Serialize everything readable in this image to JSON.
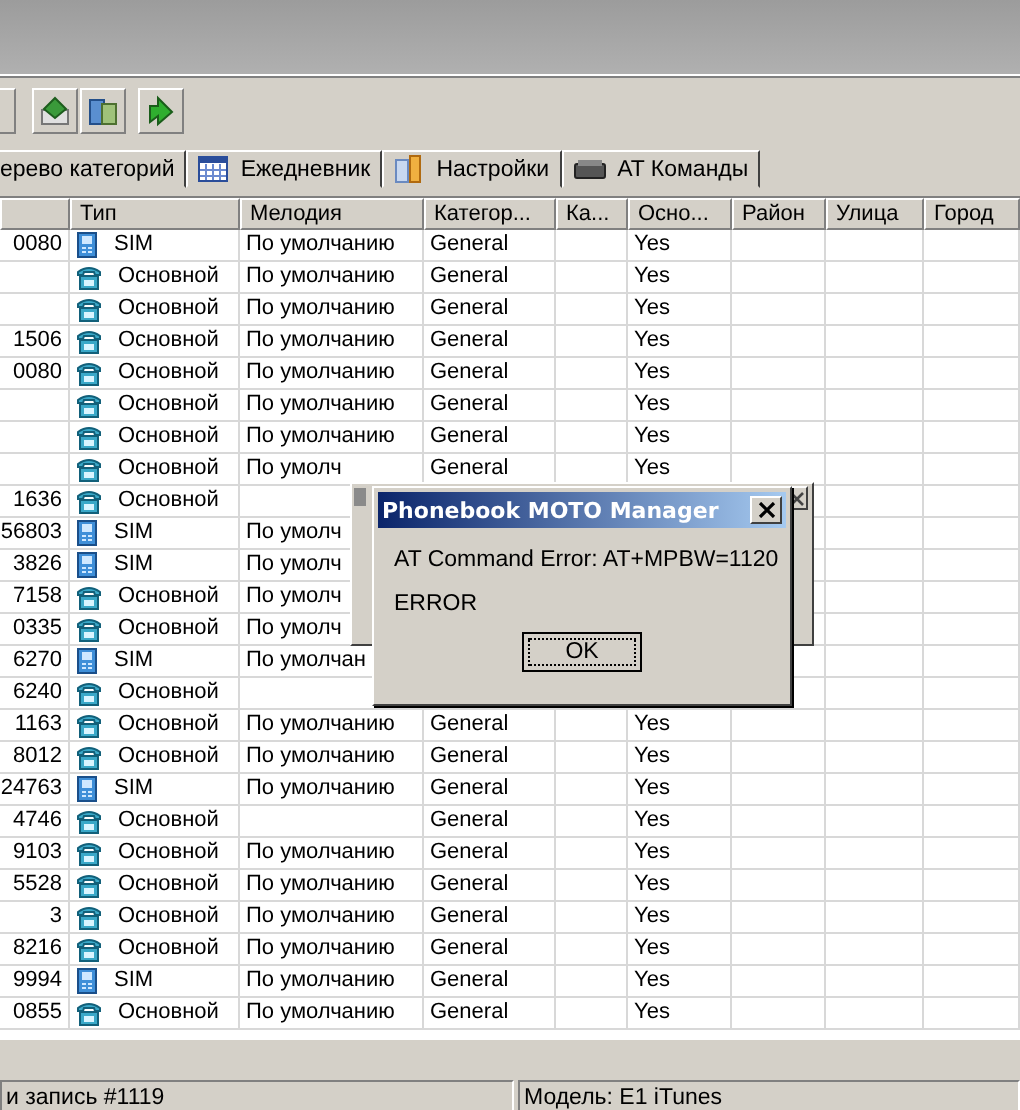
{
  "tabs": [
    {
      "label": "ерево категорий",
      "selected": false
    },
    {
      "label": "Ежедневник",
      "selected": false
    },
    {
      "label": "Настройки",
      "selected": false
    },
    {
      "label": "AT Команды",
      "selected": false
    }
  ],
  "table": {
    "columns": [
      "Тип",
      "Мелодия",
      "Категор...",
      "Ка...",
      "Осно...",
      "Район",
      "Улица",
      "Город"
    ],
    "rows": [
      {
        "number": "0080",
        "kind": "sim",
        "type": "SIM",
        "melody": "По умолчанию",
        "category": "General",
        "main": "Yes"
      },
      {
        "number": "",
        "kind": "main",
        "type": "Основной",
        "melody": "По умолчанию",
        "category": "General",
        "main": "Yes"
      },
      {
        "number": "",
        "kind": "main",
        "type": "Основной",
        "melody": "По умолчанию",
        "category": "General",
        "main": "Yes"
      },
      {
        "number": "1506",
        "kind": "main",
        "type": "Основной",
        "melody": "По умолчанию",
        "category": "General",
        "main": "Yes"
      },
      {
        "number": "0080",
        "kind": "main",
        "type": "Основной",
        "melody": "По умолчанию",
        "category": "General",
        "main": "Yes"
      },
      {
        "number": "",
        "kind": "main",
        "type": "Основной",
        "melody": "По умолчанию",
        "category": "General",
        "main": "Yes"
      },
      {
        "number": "",
        "kind": "main",
        "type": "Основной",
        "melody": "По умолчанию",
        "category": "General",
        "main": "Yes"
      },
      {
        "number": "",
        "kind": "main",
        "type": "Основной",
        "melody": "По умолч",
        "category": "General",
        "main": "Yes"
      },
      {
        "number": "1636",
        "kind": "main",
        "type": "Основной",
        "melody": "",
        "category": "",
        "main": ""
      },
      {
        "number": "56803",
        "kind": "sim",
        "type": "SIM",
        "melody": "По умолч",
        "category": "",
        "main": ""
      },
      {
        "number": "3826",
        "kind": "sim",
        "type": "SIM",
        "melody": "По умолч",
        "category": "",
        "main": ""
      },
      {
        "number": "7158",
        "kind": "main",
        "type": "Основной",
        "melody": "По умолч",
        "category": "",
        "main": ""
      },
      {
        "number": "0335",
        "kind": "main",
        "type": "Основной",
        "melody": "По умолч",
        "category": "",
        "main": ""
      },
      {
        "number": "6270",
        "kind": "sim",
        "type": "SIM",
        "melody": "По умолчан",
        "category": "",
        "main": ""
      },
      {
        "number": "6240",
        "kind": "main",
        "type": "Основной",
        "melody": "",
        "category": "",
        "main": ""
      },
      {
        "number": "1163",
        "kind": "main",
        "type": "Основной",
        "melody": "По умолчанию",
        "category": "General",
        "main": "Yes"
      },
      {
        "number": "8012",
        "kind": "main",
        "type": "Основной",
        "melody": "По умолчанию",
        "category": "General",
        "main": "Yes"
      },
      {
        "number": "24763",
        "kind": "sim",
        "type": "SIM",
        "melody": "По умолчанию",
        "category": "General",
        "main": "Yes"
      },
      {
        "number": "4746",
        "kind": "main",
        "type": "Основной",
        "melody": "",
        "category": "General",
        "main": "Yes"
      },
      {
        "number": "9103",
        "kind": "main",
        "type": "Основной",
        "melody": "По умолчанию",
        "category": "General",
        "main": "Yes"
      },
      {
        "number": "5528",
        "kind": "main",
        "type": "Основной",
        "melody": "По умолчанию",
        "category": "General",
        "main": "Yes"
      },
      {
        "number": "3",
        "kind": "main",
        "type": "Основной",
        "melody": "По умолчанию",
        "category": "General",
        "main": "Yes"
      },
      {
        "number": "8216",
        "kind": "main",
        "type": "Основной",
        "melody": "По умолчанию",
        "category": "General",
        "main": "Yes"
      },
      {
        "number": "9994",
        "kind": "sim",
        "type": "SIM",
        "melody": "По умолчанию",
        "category": "General",
        "main": "Yes"
      },
      {
        "number": "0855",
        "kind": "main",
        "type": "Основной",
        "melody": "По умолчанию",
        "category": "General",
        "main": "Yes"
      }
    ]
  },
  "dialog": {
    "title": "Phonebook MOTO Manager",
    "message": "AT Command Error: AT+MPBW=1120",
    "detail": "ERROR",
    "button": "OK"
  },
  "status_bar": [
    "и запись #1119",
    "Модель: E1 iTunes"
  ]
}
